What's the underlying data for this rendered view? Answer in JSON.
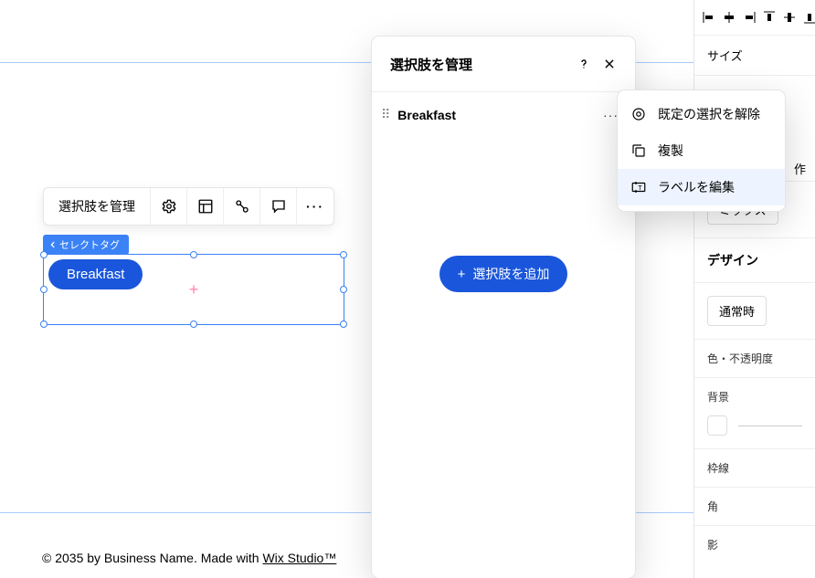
{
  "canvas": {
    "selection_label": "セレクトタグ",
    "tag_value": "Breakfast",
    "footer_text_a": "© 2035 by Business Name. Made with ",
    "footer_studio": "Wix Studio™"
  },
  "toolbar": {
    "manage_label": "選択肢を管理",
    "icons": [
      "gear-icon",
      "layout-icon",
      "link-icon",
      "comment-icon",
      "more-icon"
    ]
  },
  "modal": {
    "title": "選択肢を管理",
    "options": [
      {
        "label": "Breakfast"
      }
    ],
    "add_label": "選択肢を追加"
  },
  "context_menu": {
    "items": [
      {
        "icon": "radio-off-icon",
        "label": "既定の選択を解除"
      },
      {
        "icon": "duplicate-icon",
        "label": "複製"
      },
      {
        "icon": "rename-icon",
        "label": "ラベルを編集",
        "active": true
      }
    ]
  },
  "right_panel": {
    "align_icons": [
      "align-left-icon",
      "align-h-center-icon",
      "align-right-icon",
      "align-top-icon",
      "align-v-center-icon",
      "align-bottom-icon"
    ],
    "size_label": "サイズ",
    "action_fragment": "作",
    "mix_label": "ミックス",
    "design_label": "デザイン",
    "state_label": "通常時",
    "opacity_label": "色・不透明度",
    "bg_label": "背景",
    "border_label": "枠線",
    "corner_label": "角",
    "shadow_label": "影"
  }
}
